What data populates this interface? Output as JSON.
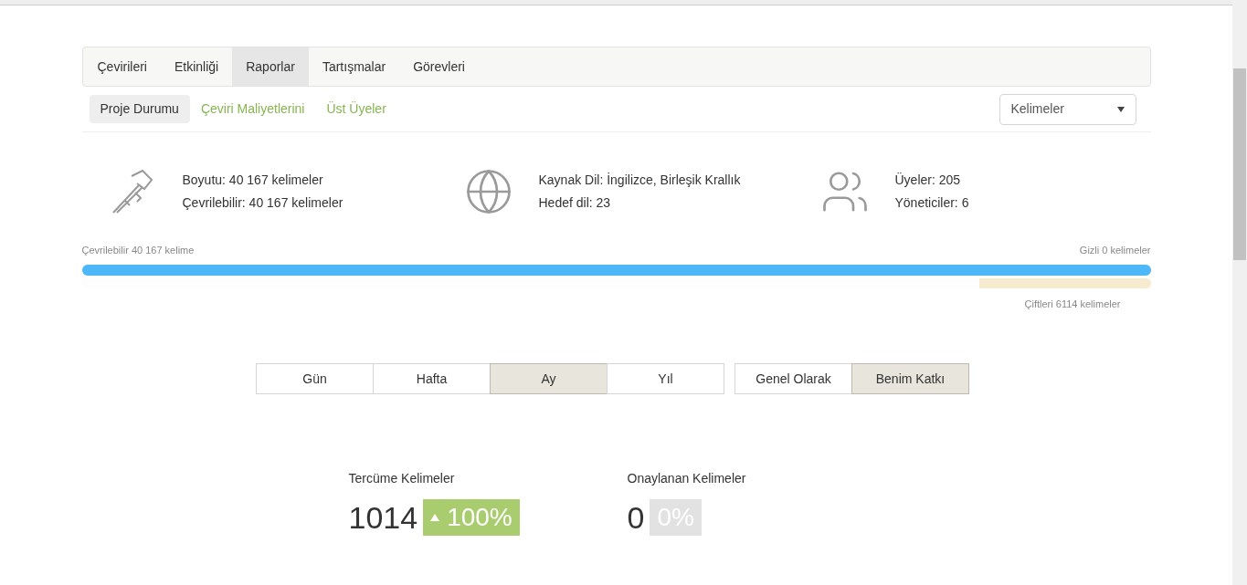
{
  "tabs": [
    {
      "label": "Çevirileri",
      "selected": false
    },
    {
      "label": "Etkinliği",
      "selected": false
    },
    {
      "label": "Raporlar",
      "selected": true
    },
    {
      "label": "Tartışmalar",
      "selected": false
    },
    {
      "label": "Görevleri",
      "selected": false
    }
  ],
  "subtabs": [
    {
      "label": "Proje Durumu",
      "selected": true
    },
    {
      "label": "Çeviri Maliyetlerini",
      "selected": false
    },
    {
      "label": "Üst Üyeler",
      "selected": false
    }
  ],
  "unit_select": {
    "value": "Kelimeler"
  },
  "info": [
    {
      "kind": "size",
      "lines": [
        "Boyutu: 40 167 kelimeler",
        "Çevrilebilir: 40 167 kelimeler"
      ]
    },
    {
      "kind": "languages",
      "lines": [
        "Kaynak Dil: İngilizce, Birleşik Krallık",
        "Hedef dil: 23"
      ]
    },
    {
      "kind": "members",
      "lines": [
        "Üyeler: 205",
        "Yöneticiler: 6"
      ]
    }
  ],
  "progress": {
    "left_label": "Çevrilebilir 40 167 kelime",
    "right_label": "Gizli 0 kelimeler",
    "level": 1
  },
  "duplicates": {
    "level": 0.16,
    "label": "Çiftleri 6114 kelimeler"
  },
  "periods": [
    {
      "label": "Gün",
      "selected": false
    },
    {
      "label": "Hafta",
      "selected": false
    },
    {
      "label": "Ay",
      "selected": true
    },
    {
      "label": "Yıl",
      "selected": false
    }
  ],
  "scopes": [
    {
      "label": "Genel Olarak",
      "selected": false
    },
    {
      "label": "Benim Katkı",
      "selected": true
    }
  ],
  "stats": [
    {
      "label": "Tercüme Kelimeler",
      "value": "1014",
      "change": "100%",
      "kind": "increase"
    },
    {
      "label": "Onaylanan Kelimeler",
      "value": "0",
      "change": "0%",
      "kind": "neutral"
    }
  ]
}
